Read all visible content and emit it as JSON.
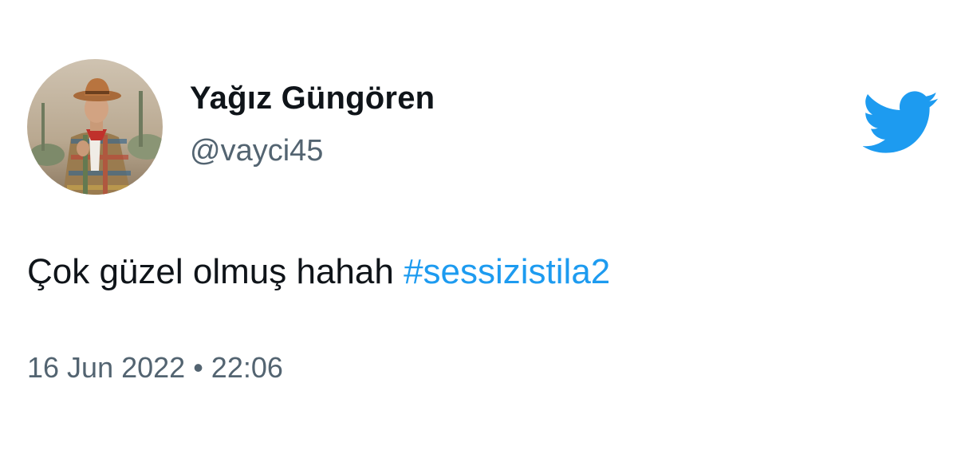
{
  "author": {
    "display_name": "Yağız Güngören",
    "handle": "@vayci45",
    "avatar_icon": "profile-photo"
  },
  "tweet": {
    "text": "Çok güzel olmuş hahah ",
    "hashtag": "#sessizistila2"
  },
  "meta": {
    "date": "16 Jun 2022",
    "separator": "•",
    "time": "22:06"
  },
  "brand": {
    "logo_icon": "twitter-bird-icon",
    "color": "#1d9bf0"
  }
}
